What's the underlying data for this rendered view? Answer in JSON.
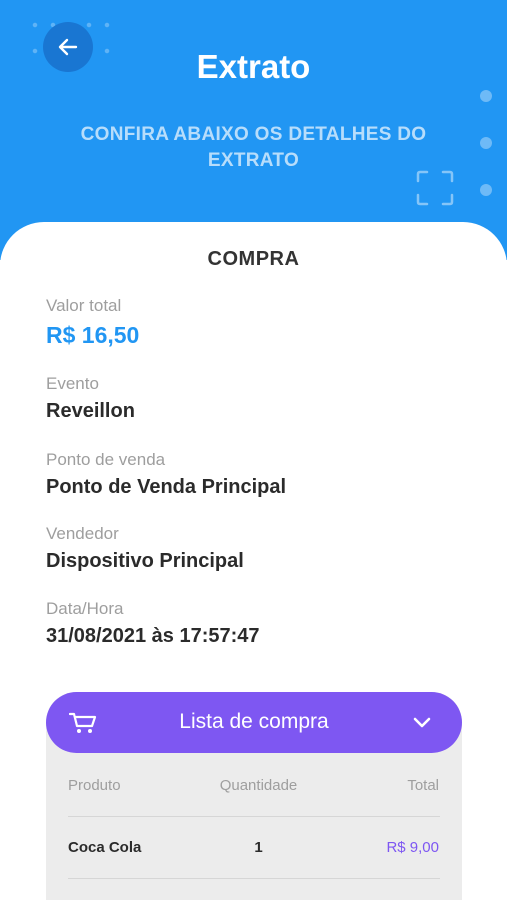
{
  "header": {
    "title": "Extrato",
    "subtitle": "CONFIRA ABAIXO OS DETALHES DO EXTRATO"
  },
  "card": {
    "title": "COMPRA",
    "fields": [
      {
        "label": "Valor total",
        "value": "R$ 16,50"
      },
      {
        "label": "Evento",
        "value": "Reveillon"
      },
      {
        "label": "Ponto de venda",
        "value": "Ponto de Venda Principal"
      },
      {
        "label": "Vendedor",
        "value": "Dispositivo Principal"
      },
      {
        "label": "Data/Hora",
        "value": "31/08/2021 às 17:57:47"
      }
    ]
  },
  "purchase_list": {
    "label": "Lista de compra",
    "columns": [
      "Produto",
      "Quantidade",
      "Total"
    ],
    "rows": [
      {
        "produto": "Coca Cola",
        "quantidade": "1",
        "total": "R$ 9,00"
      }
    ]
  },
  "colors": {
    "header_bg": "#2196f3",
    "accent_purple": "#7e57f2",
    "money_blue": "#2196f3"
  },
  "icons": [
    "back-arrow-icon",
    "scan-frame-icon",
    "cart-icon",
    "chevron-down-icon"
  ]
}
